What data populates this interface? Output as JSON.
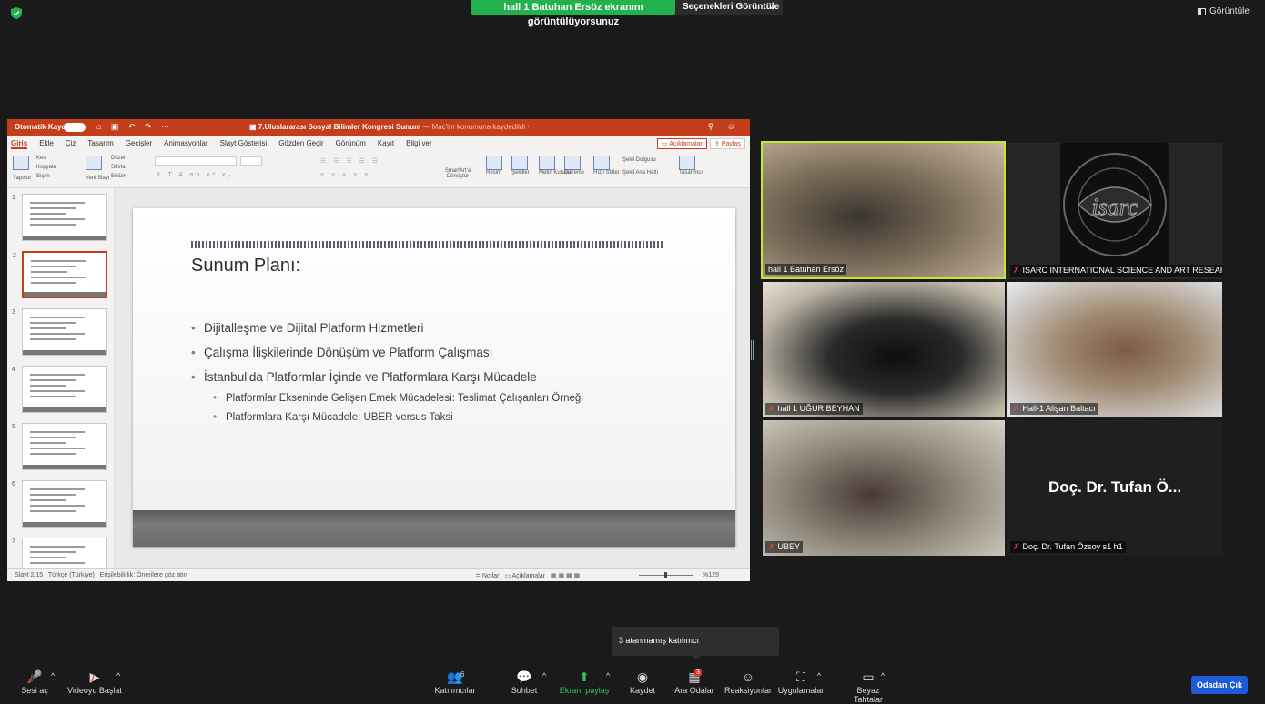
{
  "top": {
    "banner": "hall 1 Batuhan Ersöz ekranını görüntülüyorsunuz",
    "view_options": "Seçenekleri Görüntüle",
    "view_button": "Görüntüle"
  },
  "ppt": {
    "autosave_label": "Otomatik Kaydet",
    "doc_title": "7.Uluslararası Sosyal Bilimler Kongresi Sunum",
    "doc_subtitle": "— Mac'im konumuna kaydedildi ·",
    "tabs": [
      "Giriş",
      "Ekle",
      "Çiz",
      "Tasarım",
      "Geçişler",
      "Animasyonlar",
      "Slayt Gösterisi",
      "Gözden Geçir",
      "Görünüm",
      "Kayıt",
      "Bilgi ver"
    ],
    "comments_button": "Açıklamalar",
    "share_button": "Paylaş",
    "ribbon": {
      "paste": "Yapıştır",
      "cut": "Kes",
      "copy": "Kopyala",
      "format": "Biçim",
      "new_slide": "Yeni Slayt",
      "layout": "Düzen",
      "reset": "Sıfırla",
      "section": "Bölüm",
      "smartart": "SmartArt'a Dönüştür",
      "picture": "Resim",
      "shapes": "Şekiller",
      "textbox": "Metin Kutusu",
      "arrange": "Düzenle",
      "quick_styles": "Hızlı Stiller",
      "shape_fill": "Şekil Dolgusu",
      "shape_outline": "Şekil Ana Hattı",
      "designer": "Tasarımcı"
    },
    "slide": {
      "title": "Sunum Planı:",
      "bullets": [
        "Dijitalleşme ve Dijital Platform Hizmetleri",
        "Çalışma İlişkilerinde Dönüşüm ve Platform Çalışması",
        "İstanbul'da Platformlar İçinde ve Platformlara Karşı Mücadele"
      ],
      "sub_bullets": [
        "Platformlar Ekseninde Gelişen Emek Mücadelesi: Teslimat Çalışanları Örneği",
        "Platformlara Karşı Mücadele: UBER versus Taksi"
      ]
    },
    "thumb_numbers": [
      "1",
      "2",
      "3",
      "4",
      "5",
      "6",
      "7"
    ],
    "status": {
      "slide": "Slayt 2/15",
      "language": "Türkçe (Türkiye)",
      "accessibility": "Erişilebilirlik: Önerilere göz atın",
      "notes": "Notlar",
      "comments": "Açıklamalar",
      "zoom": "%129"
    }
  },
  "participants": [
    {
      "name": "hall 1 Batuhan Ersöz"
    },
    {
      "name": "ISARC INTERNATIONAL SCIENCE AND ART RESEARCH CE..."
    },
    {
      "name": "hall 1 UĞUR BEYHAN"
    },
    {
      "name": "Hall-1 Alişan Baltacı"
    },
    {
      "name": "UBEY"
    },
    {
      "name": "Doç. Dr. Tufan Özsoy s1 h1",
      "display": "Doç. Dr. Tufan Ö..."
    }
  ],
  "isarc_logo_text": "isarc",
  "tooltip": "3 atanmamış katılımcı",
  "toolbar": {
    "mute": "Sesi aç",
    "video": "Videoyu Başlat",
    "participants": "Katılımcılar",
    "participants_count": "6",
    "chat": "Sohbet",
    "share": "Ekranı paylaş",
    "record": "Kaydet",
    "breakout": "Ara Odalar",
    "breakout_badge": "3",
    "reactions": "Reaksiyonlar",
    "apps": "Uygulamalar",
    "whiteboard": "Beyaz Tahtalar",
    "leave": "Odadan Çık"
  },
  "colors": {
    "banner": "#23b14d",
    "ppt_accent": "#c43e1c",
    "active_speaker": "#c9e62f",
    "leave": "#1e5bd8"
  }
}
